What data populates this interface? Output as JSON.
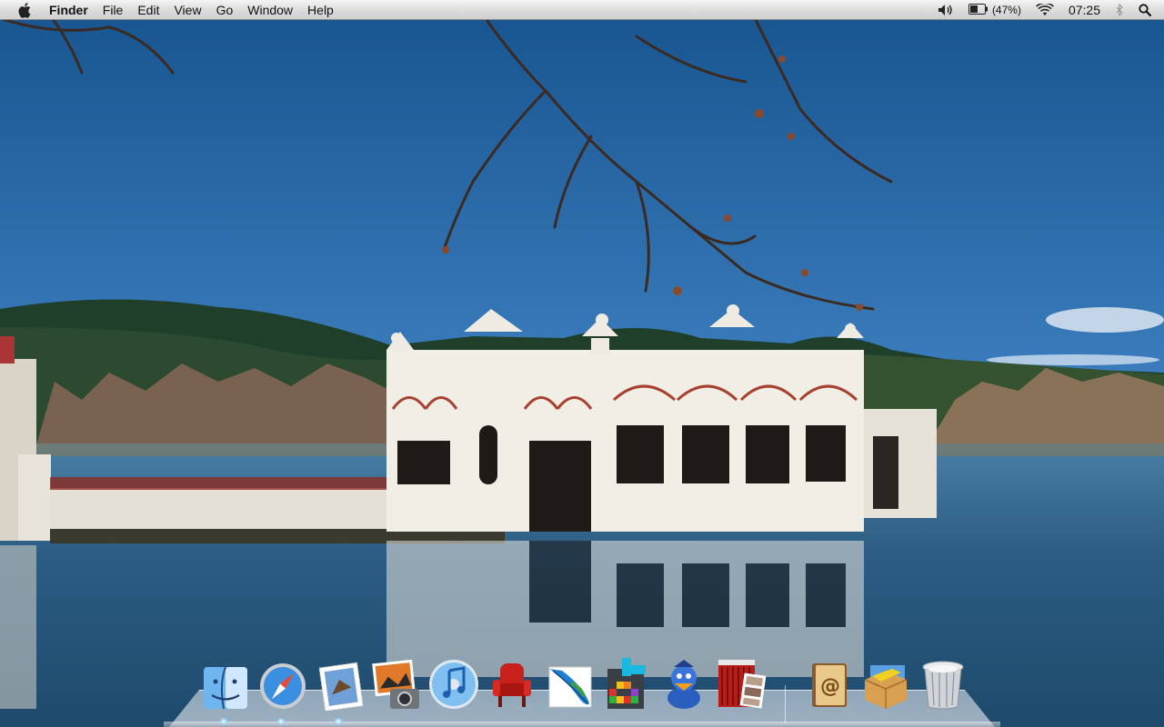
{
  "menubar": {
    "apple_icon": "apple-logo-icon",
    "app_name": "Finder",
    "menus": [
      "File",
      "Edit",
      "View",
      "Go",
      "Window",
      "Help"
    ],
    "status": {
      "volume_icon": "volume-icon",
      "battery_icon": "battery-icon",
      "battery_percent": "(47%)",
      "wifi_icon": "wifi-icon",
      "clock": "07:25",
      "bluetooth_icon": "bluetooth-icon",
      "spotlight_icon": "spotlight-icon"
    }
  },
  "dock": {
    "items": [
      {
        "name": "finder",
        "icon": "finder-icon",
        "running": true
      },
      {
        "name": "safari",
        "icon": "safari-icon",
        "running": true
      },
      {
        "name": "mail",
        "icon": "mail-stamp-icon",
        "running": true
      },
      {
        "name": "iphoto",
        "icon": "iphoto-icon",
        "running": false
      },
      {
        "name": "itunes",
        "icon": "itunes-icon",
        "running": false
      },
      {
        "name": "front-row",
        "icon": "front-row-chair-icon",
        "running": false
      },
      {
        "name": "feather",
        "icon": "feather-icon",
        "running": false
      },
      {
        "name": "puzzle",
        "icon": "tetris-blocks-icon",
        "running": false
      },
      {
        "name": "adium",
        "icon": "adium-duck-icon",
        "running": false
      },
      {
        "name": "photo-booth",
        "icon": "photo-booth-icon",
        "running": false
      },
      {
        "name": "address-book",
        "icon": "address-book-icon",
        "running": false
      },
      {
        "name": "installer",
        "icon": "package-installer-icon",
        "running": false
      },
      {
        "name": "trash",
        "icon": "trash-icon",
        "running": false
      }
    ]
  },
  "colors": {
    "sky_top": "#1f5f9c",
    "sky_bottom": "#5f9ad0",
    "water": "#1f4f74",
    "building": "#f2efe8"
  }
}
